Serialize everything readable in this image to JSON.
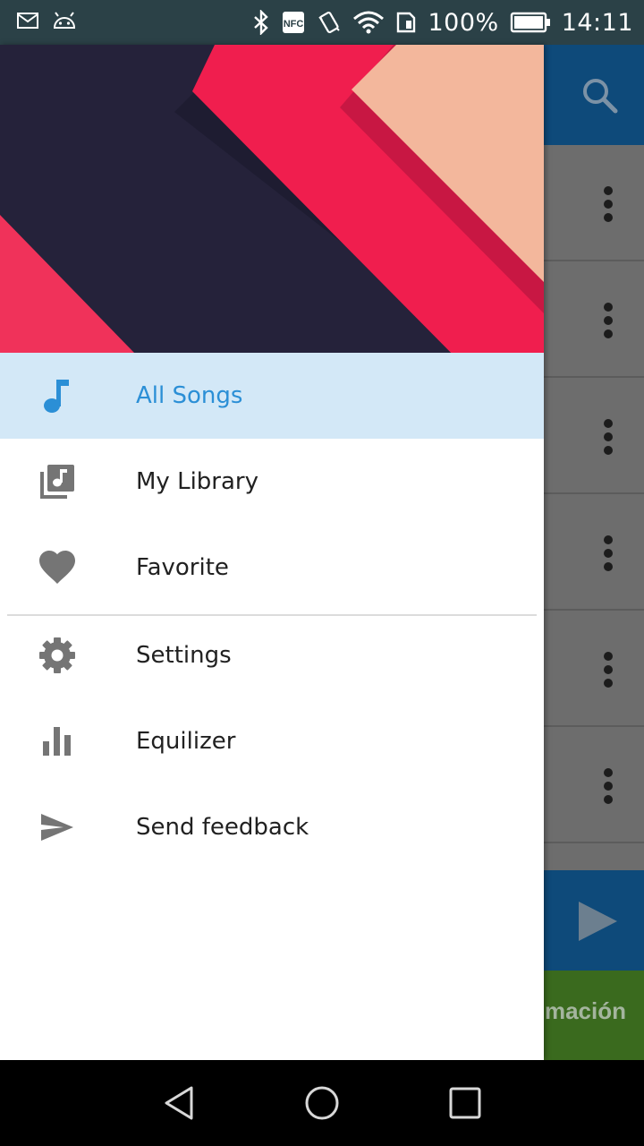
{
  "status_bar": {
    "battery_percent": "100%",
    "time": "14:11",
    "icons": [
      "mail-icon",
      "android-icon",
      "bluetooth-icon",
      "nfc-icon",
      "vibrate-icon",
      "wifi-icon",
      "sim-icon",
      "battery-icon"
    ]
  },
  "app": {
    "toolbar_icon": "search-icon",
    "row_icon": "more-vert-icon",
    "player_icon": "play-icon",
    "ad_text": "mación"
  },
  "drawer": {
    "items": [
      {
        "label": "All Songs",
        "icon": "music-note-icon",
        "active": true
      },
      {
        "label": "My Library",
        "icon": "library-music-icon",
        "active": false
      },
      {
        "label": "Favorite",
        "icon": "heart-icon",
        "active": false
      },
      {
        "label": "Settings",
        "icon": "gear-icon",
        "active": false
      },
      {
        "label": "Equilizer",
        "icon": "equalizer-icon",
        "active": false
      },
      {
        "label": "Send feedback",
        "icon": "send-icon",
        "active": false
      }
    ]
  },
  "colors": {
    "active_accent": "#2b8fd6",
    "active_bg": "#d3e8f7",
    "toolbar": "#0e4a7a",
    "status_bar": "#2b4147"
  },
  "nav": {
    "buttons": [
      "back-icon",
      "home-icon",
      "recents-icon"
    ]
  }
}
